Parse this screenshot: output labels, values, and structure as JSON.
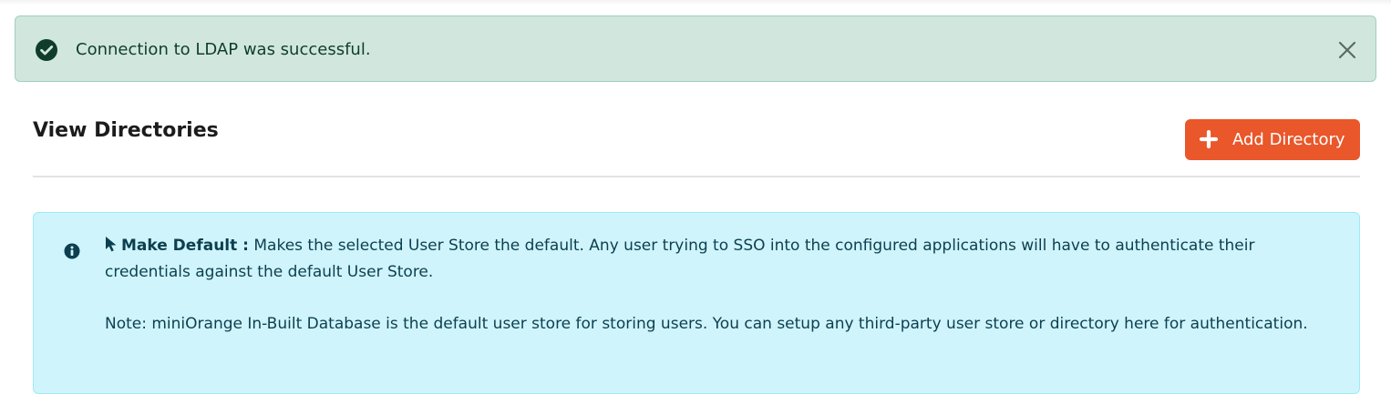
{
  "alert": {
    "message": "Connection to LDAP was successful.",
    "icon": "check-circle-icon",
    "close_icon": "close-icon",
    "color": "#d1e7dd"
  },
  "header": {
    "title": "View Directories",
    "add_button_label": "Add Directory",
    "add_button_icon": "plus-icon",
    "add_button_color": "#e9572b"
  },
  "info": {
    "icon": "info-icon",
    "make_default_label": "Make Default :",
    "make_default_text": " Makes the selected User Store the default. Any user trying to SSO into the configured applications will have to authenticate their credentials against the default User Store.",
    "note": "Note: miniOrange In-Built Database is the default user store for storing users. You can setup any third-party user store or directory here for authentication.",
    "color": "#cff4fc"
  }
}
